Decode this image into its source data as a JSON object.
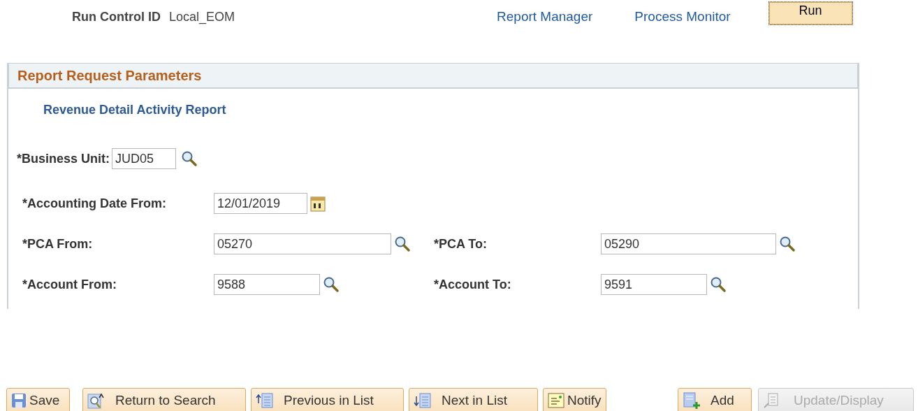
{
  "header": {
    "run_control_label": "Run Control ID",
    "run_control_value": "Local_EOM",
    "links": [
      "Report Manager",
      "Process Monitor"
    ],
    "run_button": "Run"
  },
  "panel": {
    "title": "Report Request Parameters",
    "subtitle": "Revenue Detail Activity Report",
    "business_unit": {
      "label": "*Business Unit:",
      "value": "JUD05"
    },
    "date_from": {
      "label": "*Accounting Date From:",
      "value": "12/01/2019"
    },
    "pairs": [
      {
        "from_label": "*PCA From:",
        "from_value": "05270",
        "to_label": "*PCA To:",
        "to_value": "05290",
        "kind": "wide"
      },
      {
        "from_label": "*Account From:",
        "from_value": "9588",
        "to_label": "*Account To:",
        "to_value": "9591",
        "kind": "narrow"
      }
    ]
  },
  "toolbar": [
    {
      "label": "Save",
      "kind": "save",
      "disabled": false
    },
    {
      "label": "Return to Search",
      "kind": "search",
      "disabled": false
    },
    {
      "label": "Previous in List",
      "kind": "prev",
      "disabled": false
    },
    {
      "label": "Next in List",
      "kind": "next",
      "disabled": false
    },
    {
      "label": "Notify",
      "kind": "notify",
      "disabled": false
    },
    {
      "label": "Add",
      "kind": "add",
      "disabled": false
    },
    {
      "label": "Update/Display",
      "kind": "update",
      "disabled": true
    }
  ]
}
